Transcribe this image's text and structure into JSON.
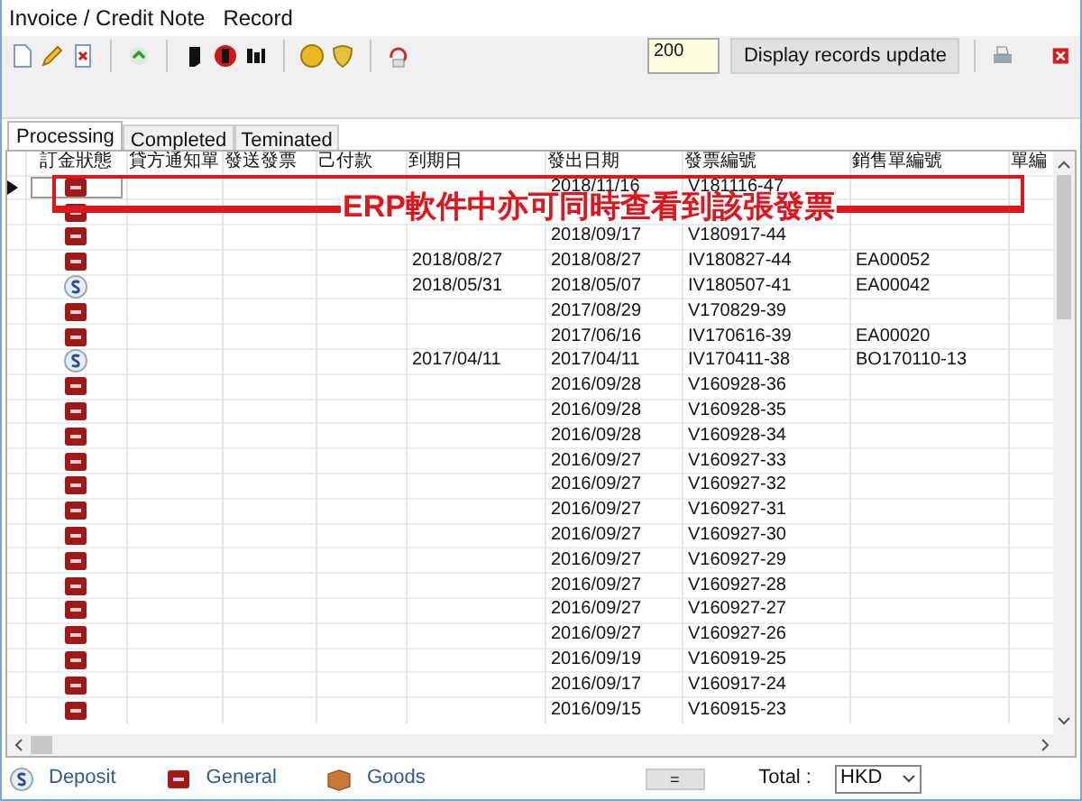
{
  "window": {
    "title": "Invoice / Credit Note   Record"
  },
  "toolbar": {
    "count": "200",
    "update_button": "Display records update"
  },
  "tabs": [
    {
      "label": "Processing",
      "selected": true
    },
    {
      "label": "Completed",
      "selected": false
    },
    {
      "label": "Teminated",
      "selected": false
    }
  ],
  "table": {
    "columns": [
      "訂金狀態",
      "貸方通知單",
      "發送發票",
      "己付款",
      "到期日",
      "發出日期",
      "發票編號",
      "銷售單編號",
      "單編"
    ],
    "rows": [
      {
        "kind": "ok",
        "selected": true,
        "due": "",
        "issued": "2018/11/16",
        "invoice": "V181116-47",
        "sales": ""
      },
      {
        "kind": "ok",
        "selected": false,
        "due": "",
        "issued": "",
        "invoice": "",
        "sales": ""
      },
      {
        "kind": "ok",
        "selected": false,
        "due": "",
        "issued": "2018/09/17",
        "invoice": "V180917-44",
        "sales": ""
      },
      {
        "kind": "ok",
        "selected": false,
        "due": "2018/08/27",
        "issued": "2018/08/27",
        "invoice": "IV180827-44",
        "sales": "EA00052"
      },
      {
        "kind": "deposit",
        "selected": false,
        "due": "2018/05/31",
        "issued": "2018/05/07",
        "invoice": "IV180507-41",
        "sales": "EA00042"
      },
      {
        "kind": "ok",
        "selected": false,
        "due": "",
        "issued": "2017/08/29",
        "invoice": "V170829-39",
        "sales": ""
      },
      {
        "kind": "ok",
        "selected": false,
        "due": "",
        "issued": "2017/06/16",
        "invoice": "IV170616-39",
        "sales": "EA00020"
      },
      {
        "kind": "deposit",
        "selected": false,
        "due": "2017/04/11",
        "issued": "2017/04/11",
        "invoice": "IV170411-38",
        "sales": "BO170110-13"
      },
      {
        "kind": "ok",
        "selected": false,
        "due": "",
        "issued": "2016/09/28",
        "invoice": "V160928-36",
        "sales": ""
      },
      {
        "kind": "ok",
        "selected": false,
        "due": "",
        "issued": "2016/09/28",
        "invoice": "V160928-35",
        "sales": ""
      },
      {
        "kind": "ok",
        "selected": false,
        "due": "",
        "issued": "2016/09/28",
        "invoice": "V160928-34",
        "sales": ""
      },
      {
        "kind": "ok",
        "selected": false,
        "due": "",
        "issued": "2016/09/27",
        "invoice": "V160927-33",
        "sales": ""
      },
      {
        "kind": "ok",
        "selected": false,
        "due": "",
        "issued": "2016/09/27",
        "invoice": "V160927-32",
        "sales": ""
      },
      {
        "kind": "ok",
        "selected": false,
        "due": "",
        "issued": "2016/09/27",
        "invoice": "V160927-31",
        "sales": ""
      },
      {
        "kind": "ok",
        "selected": false,
        "due": "",
        "issued": "2016/09/27",
        "invoice": "V160927-30",
        "sales": ""
      },
      {
        "kind": "ok",
        "selected": false,
        "due": "",
        "issued": "2016/09/27",
        "invoice": "V160927-29",
        "sales": ""
      },
      {
        "kind": "ok",
        "selected": false,
        "due": "",
        "issued": "2016/09/27",
        "invoice": "V160927-28",
        "sales": ""
      },
      {
        "kind": "ok",
        "selected": false,
        "due": "",
        "issued": "2016/09/27",
        "invoice": "V160927-27",
        "sales": ""
      },
      {
        "kind": "ok",
        "selected": false,
        "due": "",
        "issued": "2016/09/27",
        "invoice": "V160927-26",
        "sales": ""
      },
      {
        "kind": "ok",
        "selected": false,
        "due": "",
        "issued": "2016/09/19",
        "invoice": "V160919-25",
        "sales": ""
      },
      {
        "kind": "ok",
        "selected": false,
        "due": "",
        "issued": "2016/09/17",
        "invoice": "V160917-24",
        "sales": ""
      },
      {
        "kind": "ok",
        "selected": false,
        "due": "",
        "issued": "2016/09/15",
        "invoice": "V160915-23",
        "sales": ""
      }
    ]
  },
  "annotation": "ERP軟件中亦可同時查看到該張發票",
  "legend": [
    {
      "kind": "deposit",
      "label": "Deposit"
    },
    {
      "kind": "ok",
      "label": "General"
    },
    {
      "kind": "goods",
      "label": "Goods"
    }
  ],
  "footer": {
    "equals_button": "=",
    "total_label": "Total :",
    "currency": "HKD"
  }
}
